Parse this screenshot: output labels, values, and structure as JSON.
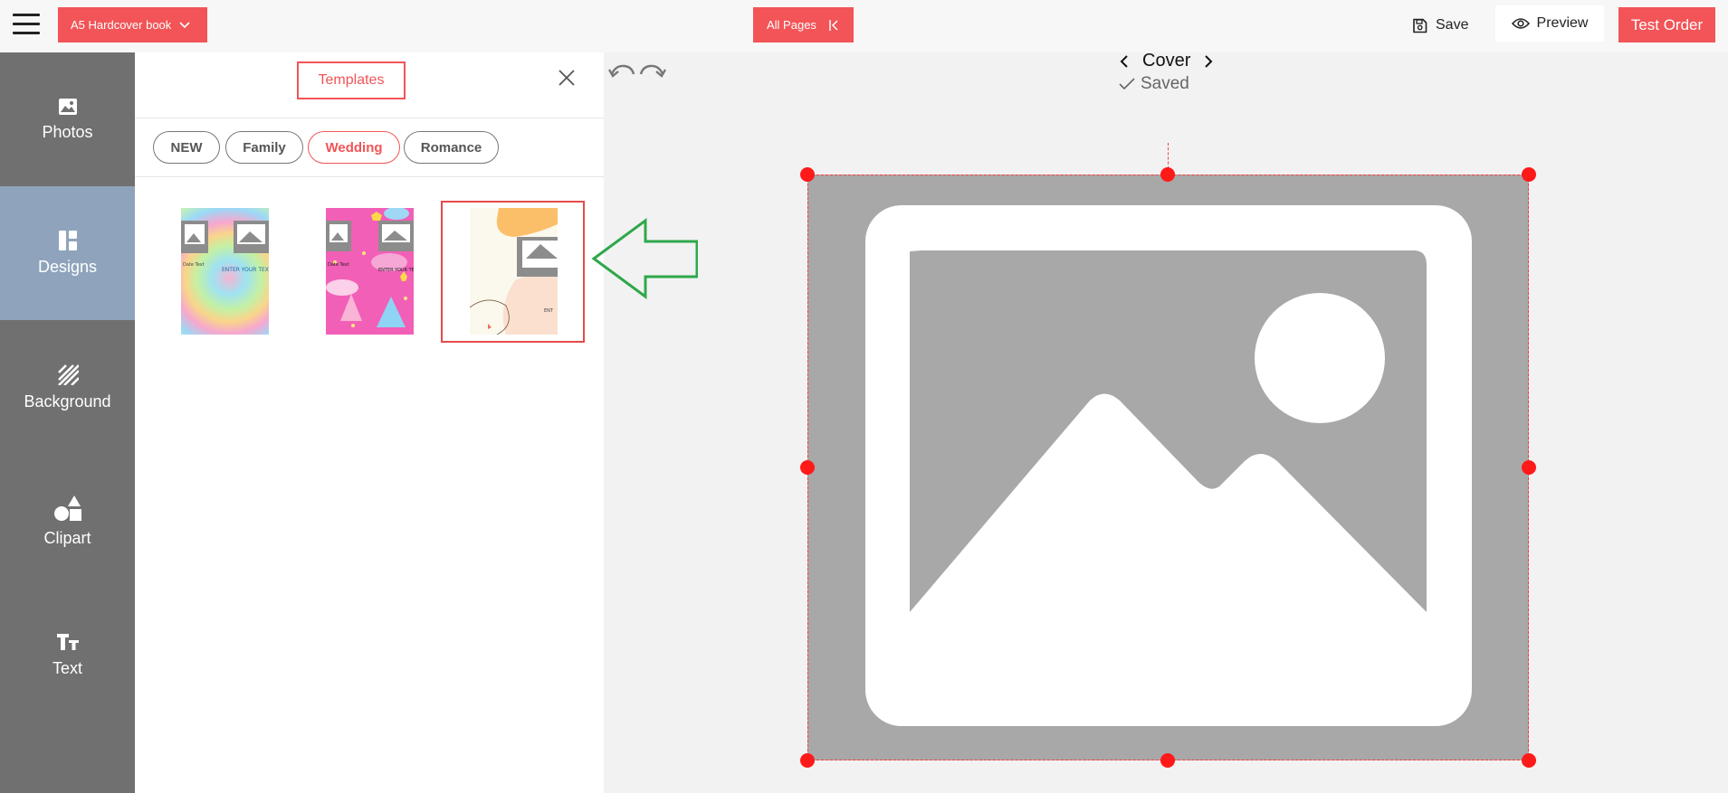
{
  "topbar": {
    "product_label": "A5 Hardcover book",
    "all_pages_label": "All Pages",
    "save_label": "Save",
    "preview_label": "Preview",
    "test_order_label": "Test Order",
    "accent_color": "#f25457"
  },
  "sidebar": {
    "items": [
      {
        "label": "Photos",
        "icon": "photo-icon"
      },
      {
        "label": "Designs",
        "icon": "designs-icon",
        "active": true
      },
      {
        "label": "Background",
        "icon": "background-icon"
      },
      {
        "label": "Clipart",
        "icon": "clipart-icon"
      },
      {
        "label": "Text",
        "icon": "text-icon"
      }
    ]
  },
  "panel": {
    "title": "Templates",
    "filters": [
      "NEW",
      "Family",
      "Wedding",
      "Romance"
    ],
    "active_filter": "Wedding",
    "templates": [
      {
        "name": "tie-dye-template"
      },
      {
        "name": "princess-template"
      },
      {
        "name": "pastel-abstract-template",
        "selected": true
      }
    ]
  },
  "canvas": {
    "page_title": "Cover",
    "save_status": "Saved"
  }
}
